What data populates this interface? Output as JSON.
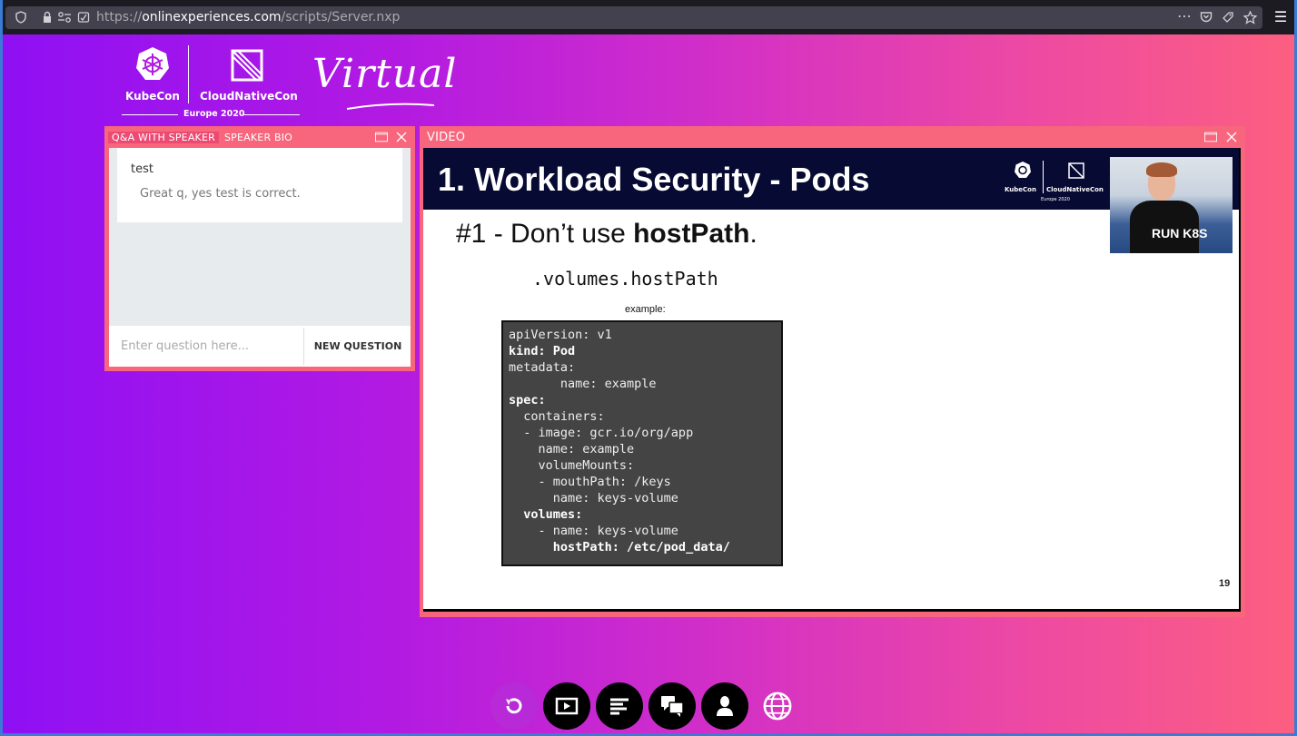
{
  "browser": {
    "url_scheme": "https://",
    "url_host": "onlinexperiences.com",
    "url_path": "/scripts/Server.nxp",
    "icons": [
      "shield-icon",
      "lock-icon",
      "permissions-icon",
      "tracking-icon",
      "more-icon",
      "pocket-icon",
      "screenshot-icon",
      "star-icon",
      "menu-icon"
    ]
  },
  "logo": {
    "kubecon": "KubeCon",
    "cloudnativecon": "CloudNativeCon",
    "event": "Europe 2020",
    "virtual": "Virtual"
  },
  "qa_panel": {
    "tabs": [
      {
        "label": "Q&A WITH SPEAKER",
        "active": true
      },
      {
        "label": "SPEAKER BIO",
        "active": false
      }
    ],
    "question": "test",
    "answer": "Great q, yes test is correct.",
    "input_placeholder": "Enter question here...",
    "submit_label": "NEW QUESTION"
  },
  "video_panel": {
    "title": "VIDEO",
    "slide": {
      "title": "1. Workload Security - Pods",
      "logo_kubecon": "KubeCon",
      "logo_cloudnative": "CloudNativeCon",
      "logo_event": "Europe 2020",
      "heading_prefix": "#1 - Don’t use ",
      "heading_bold": "hostPath",
      "heading_suffix": ".",
      "field": ".volumes.hostPath",
      "example_label": "example:",
      "code_lines": [
        "apiVersion: v1",
        "kind: Pod",
        "metadata:",
        "       name: example",
        "spec:",
        "  containers:",
        "  - image: gcr.io/org/app",
        "    name: example",
        "    volumeMounts:",
        "    - mouthPath: /keys",
        "      name: keys-volume",
        "  volumes:",
        "    - name: keys-volume",
        "      hostPath: /etc/pod_data/"
      ],
      "page_number": "19",
      "shirt_text": "RUN K8S"
    }
  },
  "toolbar": {
    "buttons": [
      "refresh-icon",
      "screen-icon",
      "agenda-icon",
      "chat-icon",
      "profile-icon",
      "globe-icon"
    ]
  },
  "colors": {
    "panel_border": "#f7667d",
    "tab_active": "#ec4a72",
    "gradient_start": "#8f10f4",
    "gradient_end": "#fc5f80"
  }
}
